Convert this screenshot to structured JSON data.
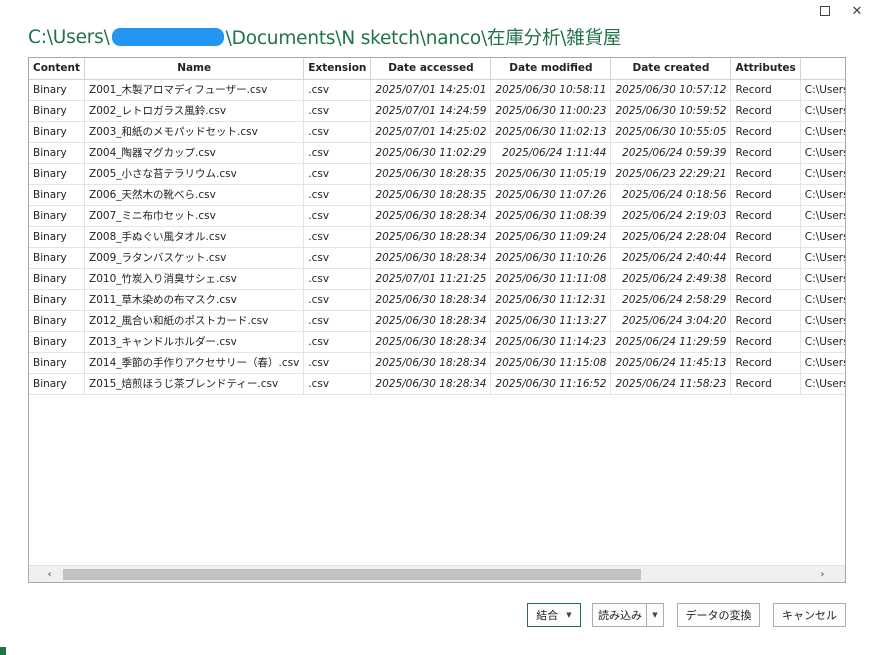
{
  "window": {
    "maximize_glyph": "maximize-icon",
    "close_glyph": "✕"
  },
  "path": {
    "prefix": "C:\\Users\\",
    "suffix": "\\Documents\\N sketch\\nanco\\在庫分析\\雑貨屋"
  },
  "columns": [
    "Content",
    "Name",
    "Extension",
    "Date accessed",
    "Date modified",
    "Date created",
    "Attributes",
    ""
  ],
  "rows": [
    {
      "content": "Binary",
      "name": "Z001_木製アロマディフューザー.csv",
      "ext": ".csv",
      "accessed": "2025/07/01 14:25:01",
      "modified": "2025/06/30 10:58:11",
      "created": "2025/06/30 10:57:12",
      "attributes": "Record",
      "folder": "C:\\Users\\"
    },
    {
      "content": "Binary",
      "name": "Z002_レトロガラス風鈴.csv",
      "ext": ".csv",
      "accessed": "2025/07/01 14:24:59",
      "modified": "2025/06/30 11:00:23",
      "created": "2025/06/30 10:59:52",
      "attributes": "Record",
      "folder": "C:\\Users\\"
    },
    {
      "content": "Binary",
      "name": "Z003_和紙のメモパッドセット.csv",
      "ext": ".csv",
      "accessed": "2025/07/01 14:25:02",
      "modified": "2025/06/30 11:02:13",
      "created": "2025/06/30 10:55:05",
      "attributes": "Record",
      "folder": "C:\\Users\\"
    },
    {
      "content": "Binary",
      "name": "Z004_陶器マグカップ.csv",
      "ext": ".csv",
      "accessed": "2025/06/30 11:02:29",
      "modified": "2025/06/24 1:11:44",
      "created": "2025/06/24 0:59:39",
      "attributes": "Record",
      "folder": "C:\\Users\\"
    },
    {
      "content": "Binary",
      "name": "Z005_小さな苔テラリウム.csv",
      "ext": ".csv",
      "accessed": "2025/06/30 18:28:35",
      "modified": "2025/06/30 11:05:19",
      "created": "2025/06/23 22:29:21",
      "attributes": "Record",
      "folder": "C:\\Users\\"
    },
    {
      "content": "Binary",
      "name": "Z006_天然木の靴べら.csv",
      "ext": ".csv",
      "accessed": "2025/06/30 18:28:35",
      "modified": "2025/06/30 11:07:26",
      "created": "2025/06/24 0:18:56",
      "attributes": "Record",
      "folder": "C:\\Users\\"
    },
    {
      "content": "Binary",
      "name": "Z007_ミニ布巾セット.csv",
      "ext": ".csv",
      "accessed": "2025/06/30 18:28:34",
      "modified": "2025/06/30 11:08:39",
      "created": "2025/06/24 2:19:03",
      "attributes": "Record",
      "folder": "C:\\Users\\"
    },
    {
      "content": "Binary",
      "name": "Z008_手ぬぐい風タオル.csv",
      "ext": ".csv",
      "accessed": "2025/06/30 18:28:34",
      "modified": "2025/06/30 11:09:24",
      "created": "2025/06/24 2:28:04",
      "attributes": "Record",
      "folder": "C:\\Users\\"
    },
    {
      "content": "Binary",
      "name": "Z009_ラタンバスケット.csv",
      "ext": ".csv",
      "accessed": "2025/06/30 18:28:34",
      "modified": "2025/06/30 11:10:26",
      "created": "2025/06/24 2:40:44",
      "attributes": "Record",
      "folder": "C:\\Users\\"
    },
    {
      "content": "Binary",
      "name": "Z010_竹炭入り消臭サシェ.csv",
      "ext": ".csv",
      "accessed": "2025/07/01 11:21:25",
      "modified": "2025/06/30 11:11:08",
      "created": "2025/06/24 2:49:38",
      "attributes": "Record",
      "folder": "C:\\Users\\"
    },
    {
      "content": "Binary",
      "name": "Z011_草木染めの布マスク.csv",
      "ext": ".csv",
      "accessed": "2025/06/30 18:28:34",
      "modified": "2025/06/30 11:12:31",
      "created": "2025/06/24 2:58:29",
      "attributes": "Record",
      "folder": "C:\\Users\\"
    },
    {
      "content": "Binary",
      "name": "Z012_風合い和紙のポストカード.csv",
      "ext": ".csv",
      "accessed": "2025/06/30 18:28:34",
      "modified": "2025/06/30 11:13:27",
      "created": "2025/06/24 3:04:20",
      "attributes": "Record",
      "folder": "C:\\Users\\"
    },
    {
      "content": "Binary",
      "name": "Z013_キャンドルホルダー.csv",
      "ext": ".csv",
      "accessed": "2025/06/30 18:28:34",
      "modified": "2025/06/30 11:14:23",
      "created": "2025/06/24 11:29:59",
      "attributes": "Record",
      "folder": "C:\\Users\\"
    },
    {
      "content": "Binary",
      "name": "Z014_季節の手作りアクセサリー（春）.csv",
      "ext": ".csv",
      "accessed": "2025/06/30 18:28:34",
      "modified": "2025/06/30 11:15:08",
      "created": "2025/06/24 11:45:13",
      "attributes": "Record",
      "folder": "C:\\Users\\"
    },
    {
      "content": "Binary",
      "name": "Z015_焙煎ほうじ茶ブレンドティー.csv",
      "ext": ".csv",
      "accessed": "2025/06/30 18:28:34",
      "modified": "2025/06/30 11:16:52",
      "created": "2025/06/24 11:58:23",
      "attributes": "Record",
      "folder": "C:\\Users\\"
    }
  ],
  "scrollbar": {
    "left_glyph": "‹",
    "right_glyph": "›"
  },
  "buttons": {
    "combine": "結合",
    "load": "読み込み",
    "transform": "データの変換",
    "cancel": "キャンセル"
  },
  "colors": {
    "accent": "#217346",
    "redaction": "#2196f3"
  }
}
